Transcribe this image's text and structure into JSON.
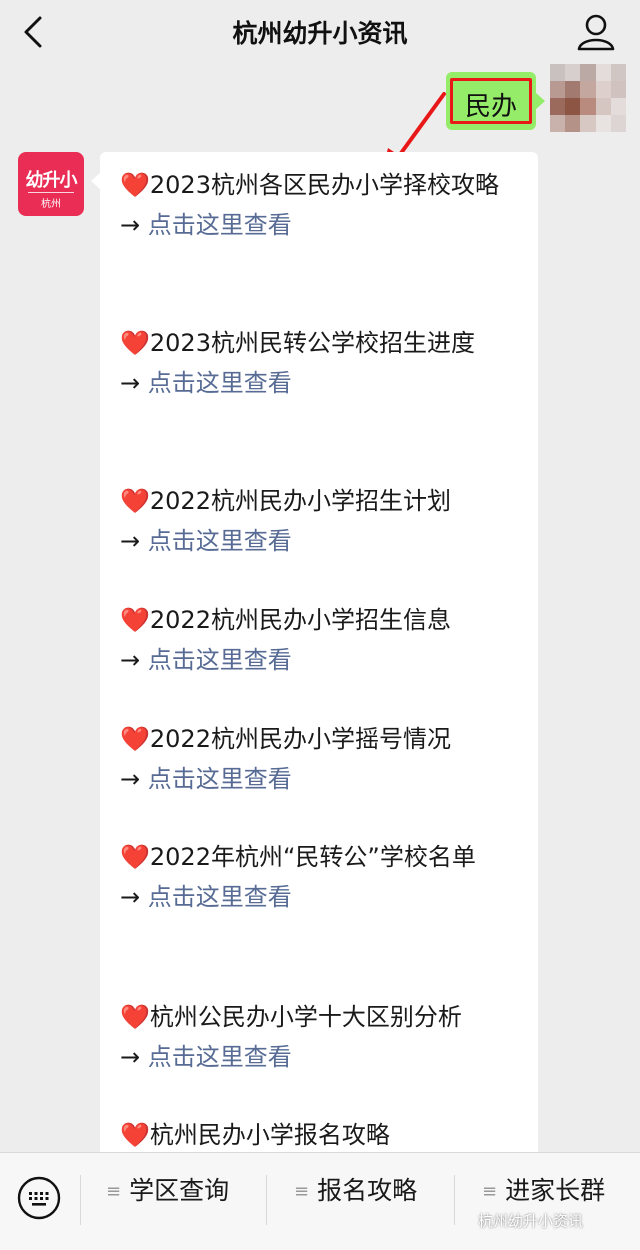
{
  "header": {
    "title": "杭州幼升小资讯",
    "back_icon": "chevron-left-icon",
    "profile_icon": "person-icon"
  },
  "user_message": {
    "text": "民办"
  },
  "bot": {
    "avatar": {
      "line1": "幼升小",
      "line2": "杭州"
    },
    "items": [
      {
        "heart": "❤️",
        "title": "2023杭州各区民办小学择校攻略",
        "arrow": "→ ",
        "link": "点击这里查看"
      },
      {
        "heart": "❤️",
        "title": "2023杭州民转公学校招生进度",
        "arrow": "→ ",
        "link": "点击这里查看"
      },
      {
        "heart": "❤️",
        "title": "2022杭州民办小学招生计划",
        "arrow": "→ ",
        "link": "点击这里查看"
      },
      {
        "heart": "❤️",
        "title": "2022杭州民办小学招生信息",
        "arrow": "→ ",
        "link": "点击这里查看"
      },
      {
        "heart": "❤️",
        "title": "2022杭州民办小学摇号情况",
        "arrow": "→ ",
        "link": "点击这里查看"
      },
      {
        "heart": "❤️",
        "title": "2022年杭州“民转公”学校名单",
        "arrow": "→ ",
        "link": "点击这里查看"
      },
      {
        "heart": "❤️",
        "title": "杭州公民办小学十大区别分析",
        "arrow": "→ ",
        "link": "点击这里查看"
      },
      {
        "heart": "❤️",
        "title": "杭州民办小学报名攻略"
      }
    ]
  },
  "bottom_menu": {
    "keyboard_icon": "keyboard-icon",
    "items": [
      {
        "icon": "menu-lines-icon",
        "label": "学区查询"
      },
      {
        "icon": "menu-lines-icon",
        "label": "报名攻略"
      },
      {
        "icon": "menu-lines-icon",
        "label": "进家长群"
      }
    ]
  },
  "watermark": "杭州幼升小资讯",
  "colors": {
    "user_bubble": "#95ec69",
    "highlight": "#e81818",
    "link": "#576b95",
    "heart": "#e8202e",
    "brand": "#e92d54"
  }
}
